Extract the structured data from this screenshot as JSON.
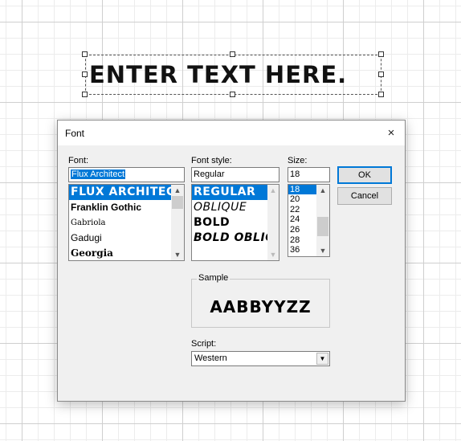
{
  "canvas": {
    "text": "ENTER TEXT HERE."
  },
  "dialog": {
    "title": "Font",
    "close_icon": "×",
    "font_label": "Font:",
    "font_value": "Flux Architect",
    "font_list": [
      "FLUX ARCHITECT",
      "Franklin Gothic",
      "Gabriola",
      "Gadugi",
      "Georgia"
    ],
    "style_label": "Font style:",
    "style_value": "Regular",
    "style_list": [
      "REGULAR",
      "OBLIQUE",
      "BOLD",
      "BOLD OBLIQUE"
    ],
    "size_label": "Size:",
    "size_value": "18",
    "size_list": [
      "18",
      "20",
      "22",
      "24",
      "26",
      "28",
      "36"
    ],
    "ok_label": "OK",
    "cancel_label": "Cancel",
    "sample_label": "Sample",
    "sample_text": "AABBYYZZ",
    "script_label": "Script:",
    "script_value": "Western",
    "scroll_up_icon": "▲",
    "scroll_down_icon": "▼",
    "dropdown_icon": "▼",
    "accent_color": "#0078d7"
  }
}
